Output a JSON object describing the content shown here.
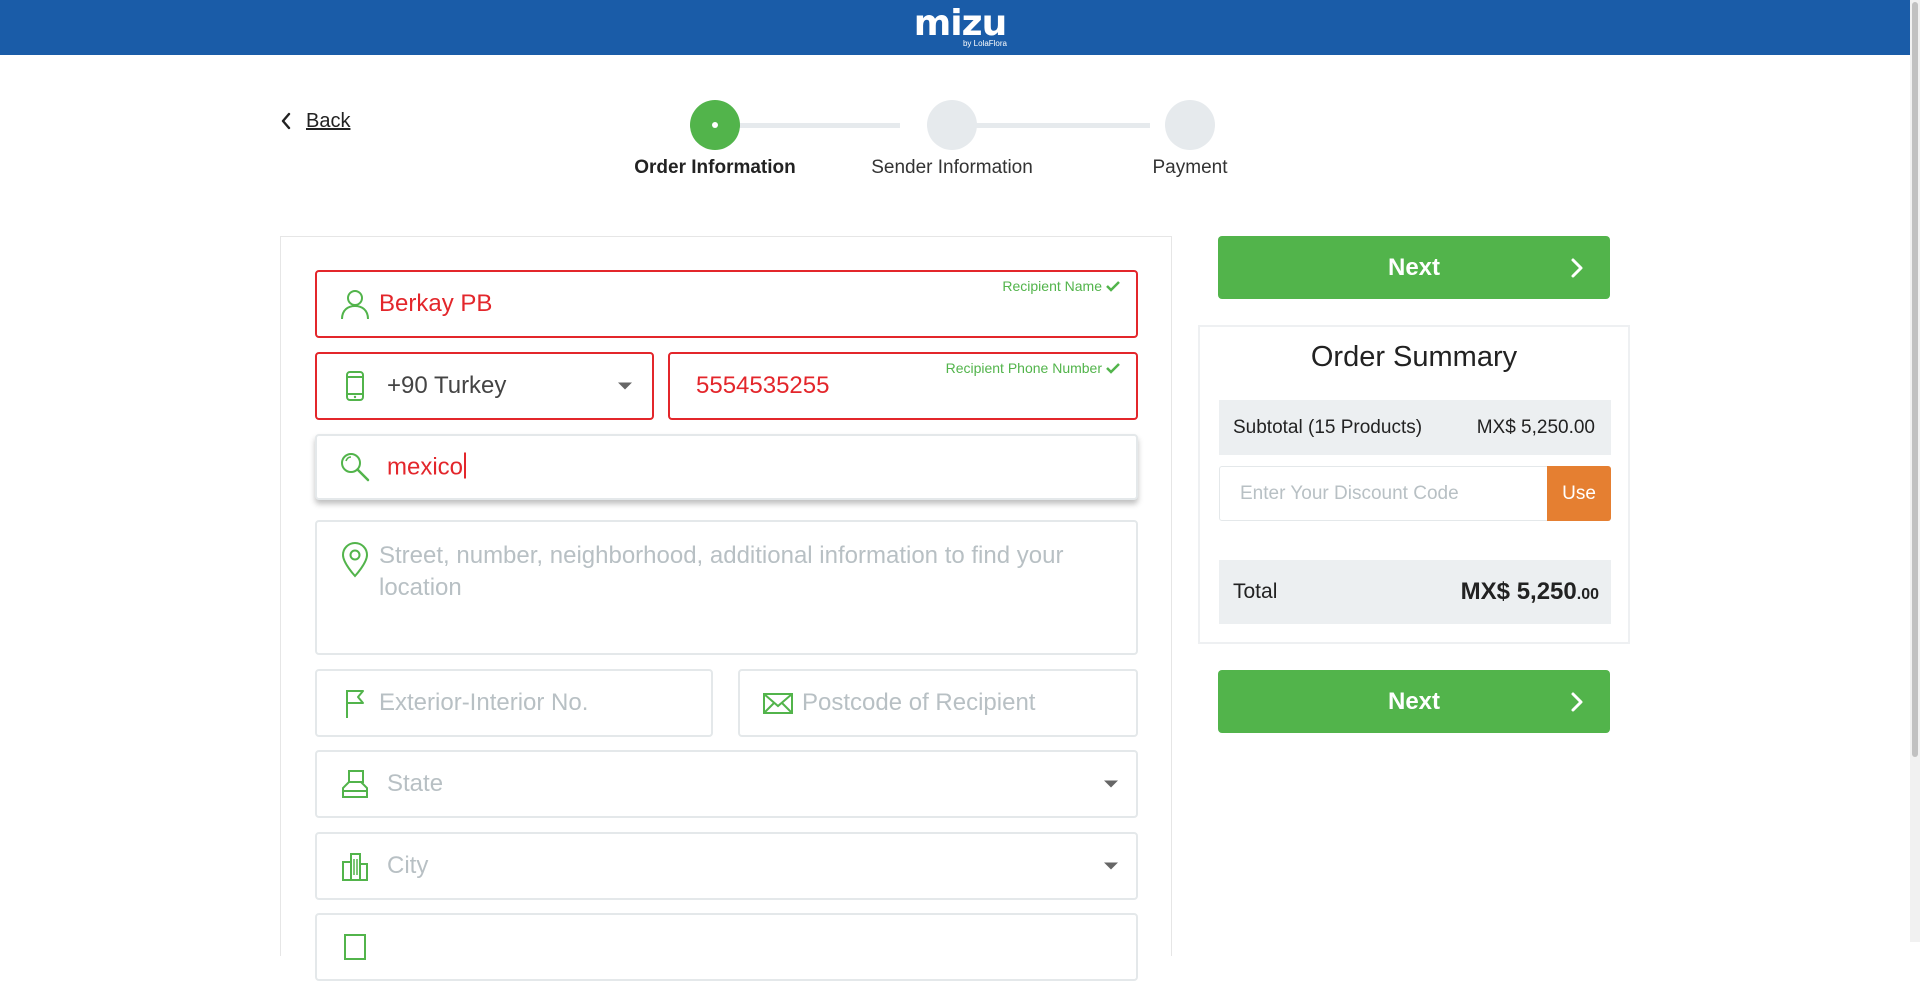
{
  "brand": {
    "name": "mizu",
    "tagline": "by LolaFlora",
    "primary_color": "#1a5ca8",
    "accent_green": "#52b44b",
    "error_red": "#e3262b",
    "use_orange": "#e57f31"
  },
  "nav": {
    "back_label": "Back"
  },
  "steps": [
    {
      "label": "Order Information",
      "state": "active"
    },
    {
      "label": "Sender Information",
      "state": "pending"
    },
    {
      "label": "Payment",
      "state": "pending"
    }
  ],
  "form": {
    "recipient_name": {
      "value": "Berkay PB",
      "label": "Recipient Name",
      "icon": "person-icon"
    },
    "phone_country": {
      "value": "+90 Turkey",
      "icon": "phone-icon"
    },
    "phone_number": {
      "value": "5554535255",
      "label": "Recipient Phone Number"
    },
    "location_search": {
      "value": "mexico",
      "icon": "search-icon"
    },
    "address": {
      "placeholder": "Street, number, neighborhood, additional information to find your location",
      "icon": "location-pin-icon"
    },
    "exterior_interior": {
      "placeholder": "Exterior-Interior No.",
      "icon": "flag-icon"
    },
    "postcode": {
      "placeholder": "Postcode of Recipient",
      "icon": "envelope-icon"
    },
    "state": {
      "placeholder": "State",
      "icon": "state-icon"
    },
    "city": {
      "placeholder": "City",
      "icon": "city-icon"
    }
  },
  "actions": {
    "next_label": "Next"
  },
  "summary": {
    "title": "Order Summary",
    "subtotal_label": "Subtotal (15 Products)",
    "subtotal_value": "MX$ 5,250.00",
    "discount_placeholder": "Enter Your Discount Code",
    "use_label": "Use",
    "total_label": "Total",
    "total_value_main": "MX$ 5,250",
    "total_value_cents": ".00"
  }
}
